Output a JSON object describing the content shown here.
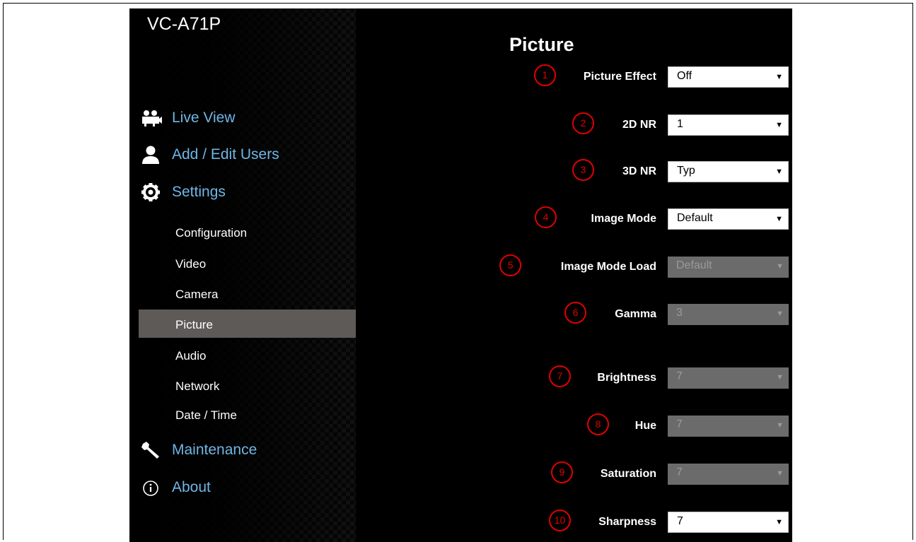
{
  "brand": "VC-A71P",
  "nav": {
    "live_view": "Live View",
    "add_edit_users": "Add / Edit Users",
    "settings": "Settings",
    "sub": [
      "Configuration",
      "Video",
      "Camera",
      "Picture",
      "Audio",
      "Network",
      "Date / Time"
    ],
    "active_sub": "Picture",
    "maintenance": "Maintenance",
    "about": "About"
  },
  "page": {
    "title": "Picture"
  },
  "settings": [
    {
      "n": "1",
      "label": "Picture Effect",
      "value": "Off",
      "enabled": true
    },
    {
      "n": "2",
      "label": "2D NR",
      "value": "1",
      "enabled": true
    },
    {
      "n": "3",
      "label": "3D NR",
      "value": "Typ",
      "enabled": true
    },
    {
      "n": "4",
      "label": "Image Mode",
      "value": "Default",
      "enabled": true
    },
    {
      "n": "5",
      "label": "Image Mode Load",
      "value": "Default",
      "enabled": false
    },
    {
      "n": "6",
      "label": "Gamma",
      "value": "3",
      "enabled": false
    },
    {
      "n": "7",
      "label": "Brightness",
      "value": "7",
      "enabled": false
    },
    {
      "n": "8",
      "label": "Hue",
      "value": "7",
      "enabled": false
    },
    {
      "n": "9",
      "label": "Saturation",
      "value": "7",
      "enabled": false
    },
    {
      "n": "10",
      "label": "Sharpness",
      "value": "7",
      "enabled": true
    }
  ],
  "colors": {
    "accent_link": "#6fb6e6",
    "annotation": "#e10000",
    "active_bg": "#5e5a57"
  },
  "icons": {
    "live_view": "video-camera-people-icon",
    "users": "user-icon",
    "settings": "gear-icon",
    "maintenance": "wrench-icon",
    "about": "info-circle-icon",
    "dropdown": "triangle-down-icon"
  }
}
